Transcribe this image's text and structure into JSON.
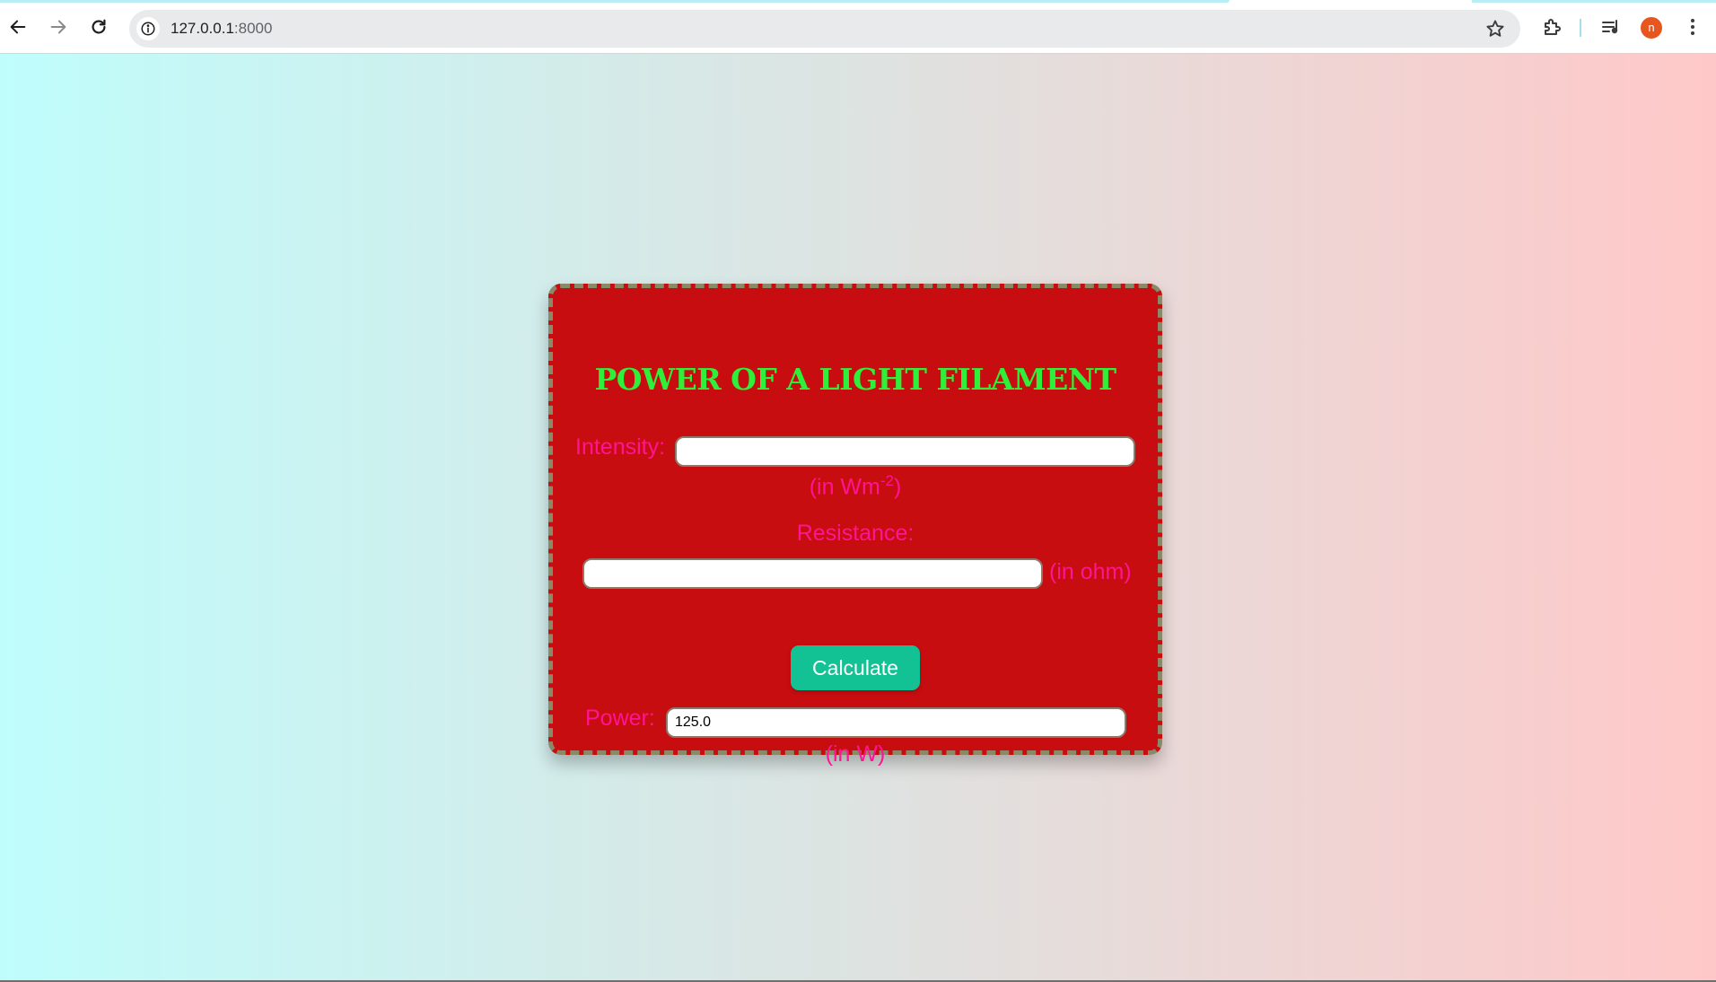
{
  "browser": {
    "url_host": "127.0.0.1",
    "url_port": ":8000",
    "profile_initial": "n"
  },
  "form": {
    "title": "POWER OF A LIGHT FILAMENT",
    "intensity_label": "Intensity:",
    "intensity_value": "",
    "intensity_unit_prefix": "(in Wm",
    "intensity_unit_exp": "-2",
    "intensity_unit_suffix": ")",
    "resistance_label": "Resistance:",
    "resistance_value": "",
    "resistance_unit": "(in ohm)",
    "calculate_label": "Calculate",
    "power_label": "Power:",
    "power_value": "125.0",
    "power_unit": "(in W)"
  },
  "colors": {
    "card_background": "#c70d10",
    "title": "#2ef03a",
    "labels": "#ff1493",
    "button": "#12c294"
  }
}
